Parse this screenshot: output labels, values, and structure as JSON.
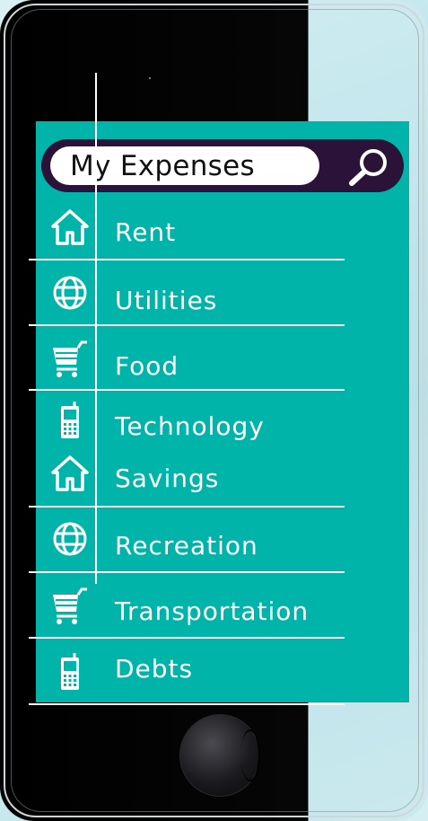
{
  "search": {
    "value": "My Expenses"
  },
  "menu": {
    "items": [
      {
        "label": "Rent",
        "icon": "home-icon"
      },
      {
        "label": "Utilities",
        "icon": "globe-icon"
      },
      {
        "label": "Food",
        "icon": "cart-icon"
      },
      {
        "label": "Technology",
        "icon": "phone-icon"
      },
      {
        "label": "Savings",
        "icon": "home-icon"
      },
      {
        "label": "Recreation",
        "icon": "globe-icon"
      },
      {
        "label": "Transportation",
        "icon": "cart-icon"
      },
      {
        "label": "Debts",
        "icon": "phone-icon"
      }
    ]
  },
  "colors": {
    "screen_bg": "#00b4aa",
    "search_bar_bg": "#2b1238",
    "text": "#ffffff"
  }
}
